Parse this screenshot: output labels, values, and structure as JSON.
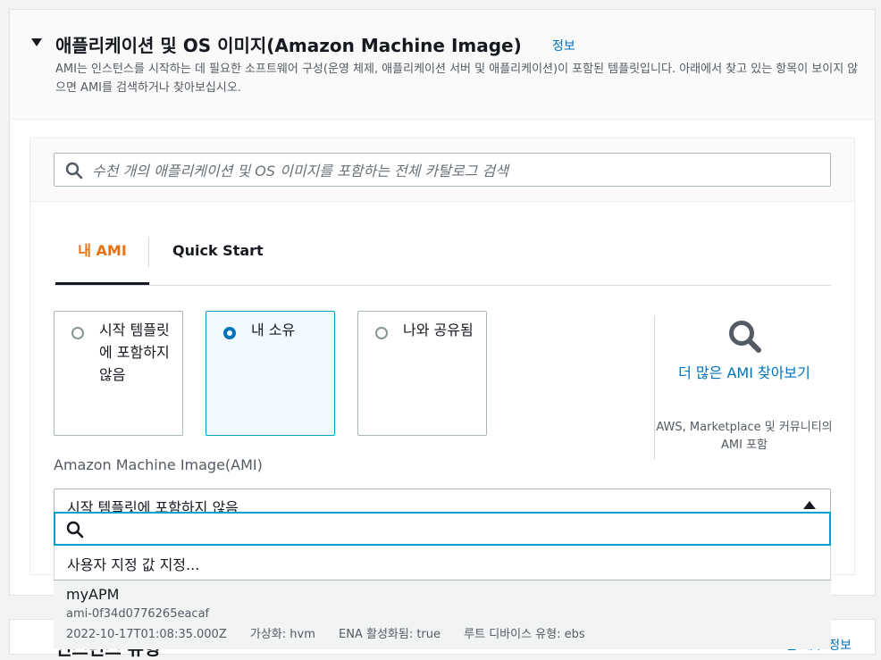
{
  "section": {
    "title": "애플리케이션 및 OS 이미지(Amazon Machine Image)",
    "info_link": "정보",
    "description": "AMI는 인스턴스를 시작하는 데 필요한 소프트웨어 구성(운영 체제, 애플리케이션 서버 및 애플리케이션)이 포함된 템플릿입니다. 아래에서 찾고 있는 항목이 보이지 않으면 AMI를 검색하거나 찾아보십시오."
  },
  "search": {
    "placeholder": "수천 개의 애플리케이션 및 OS 이미지를 포함하는 전체 카탈로그 검색"
  },
  "tabs": [
    {
      "label": "내 AMI",
      "active": true
    },
    {
      "label": "Quick Start",
      "active": false
    }
  ],
  "ownership_options": [
    {
      "label": "시작 템플릿에 포함하지 않음",
      "selected": false
    },
    {
      "label": "내 소유",
      "selected": true
    },
    {
      "label": "나와 공유됨",
      "selected": false
    }
  ],
  "browse": {
    "link": "더 많은 AMI 찾아보기",
    "sub": "AWS, Marketplace 및 커뮤니티의 AMI 포함"
  },
  "ami_select": {
    "label": "Amazon Machine Image(AMI)",
    "value": "시작 템플릿에 포함하지 않음",
    "filter_placeholder": "",
    "custom_option": "사용자 지정 값 지정...",
    "items": [
      {
        "name": "myAPM",
        "id": "ami-0f34d0776265eacaf",
        "date": "2022-10-17T01:08:35.000Z",
        "virtualization": "가상화: hvm",
        "ena": "ENA 활성화됨: true",
        "root_device": "루트 디바이스 유형: ebs"
      }
    ]
  },
  "next_section": {
    "title": "인스턴스 유형",
    "link": "고급 세부 정보"
  }
}
